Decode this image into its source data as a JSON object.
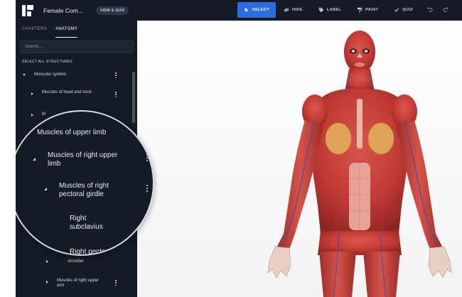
{
  "topbar": {
    "app_title": "Female Com...",
    "mode_pill": "VIEW & QUIZ",
    "tools": [
      {
        "label": "SELECT",
        "icon": "cursor-icon",
        "active": true
      },
      {
        "label": "HIDE",
        "icon": "eye-off-icon",
        "active": false
      },
      {
        "label": "LABEL",
        "icon": "tag-icon",
        "active": false
      },
      {
        "label": "PAINT",
        "icon": "paint-icon",
        "active": false
      },
      {
        "label": "QUIZ",
        "icon": "check-icon",
        "active": false
      }
    ],
    "accent": "#2d6cdf"
  },
  "sidebar": {
    "tabs": [
      {
        "label": "CHAPTERS",
        "active": false
      },
      {
        "label": "ANATOMY",
        "active": true
      }
    ],
    "search_placeholder": "Search...",
    "select_all": "SELECT ALL STRUCTURES",
    "tree": [
      {
        "label": "Muscular system",
        "expanded": true
      },
      {
        "label": "Muscles of head and neck",
        "expanded": false
      },
      {
        "label": "M",
        "expanded": false
      },
      {
        "label": "shoulder",
        "expanded": false
      },
      {
        "label": "Muscles of right upper arm",
        "expanded": false
      }
    ]
  },
  "magnifier": {
    "items": [
      {
        "label": "Muscles of upper limb"
      },
      {
        "label": "Muscles of right upper limb"
      },
      {
        "label": "Muscles of right pectoral girdle"
      },
      {
        "label": "Right subclavius"
      },
      {
        "label": "Right pectoralis minor"
      }
    ]
  },
  "colors": {
    "sidebar_bg": "#141a26",
    "muscle": "#c23a35",
    "breast_tissue": "#e0a257",
    "skin_muscle_light": "#e58b7a"
  }
}
